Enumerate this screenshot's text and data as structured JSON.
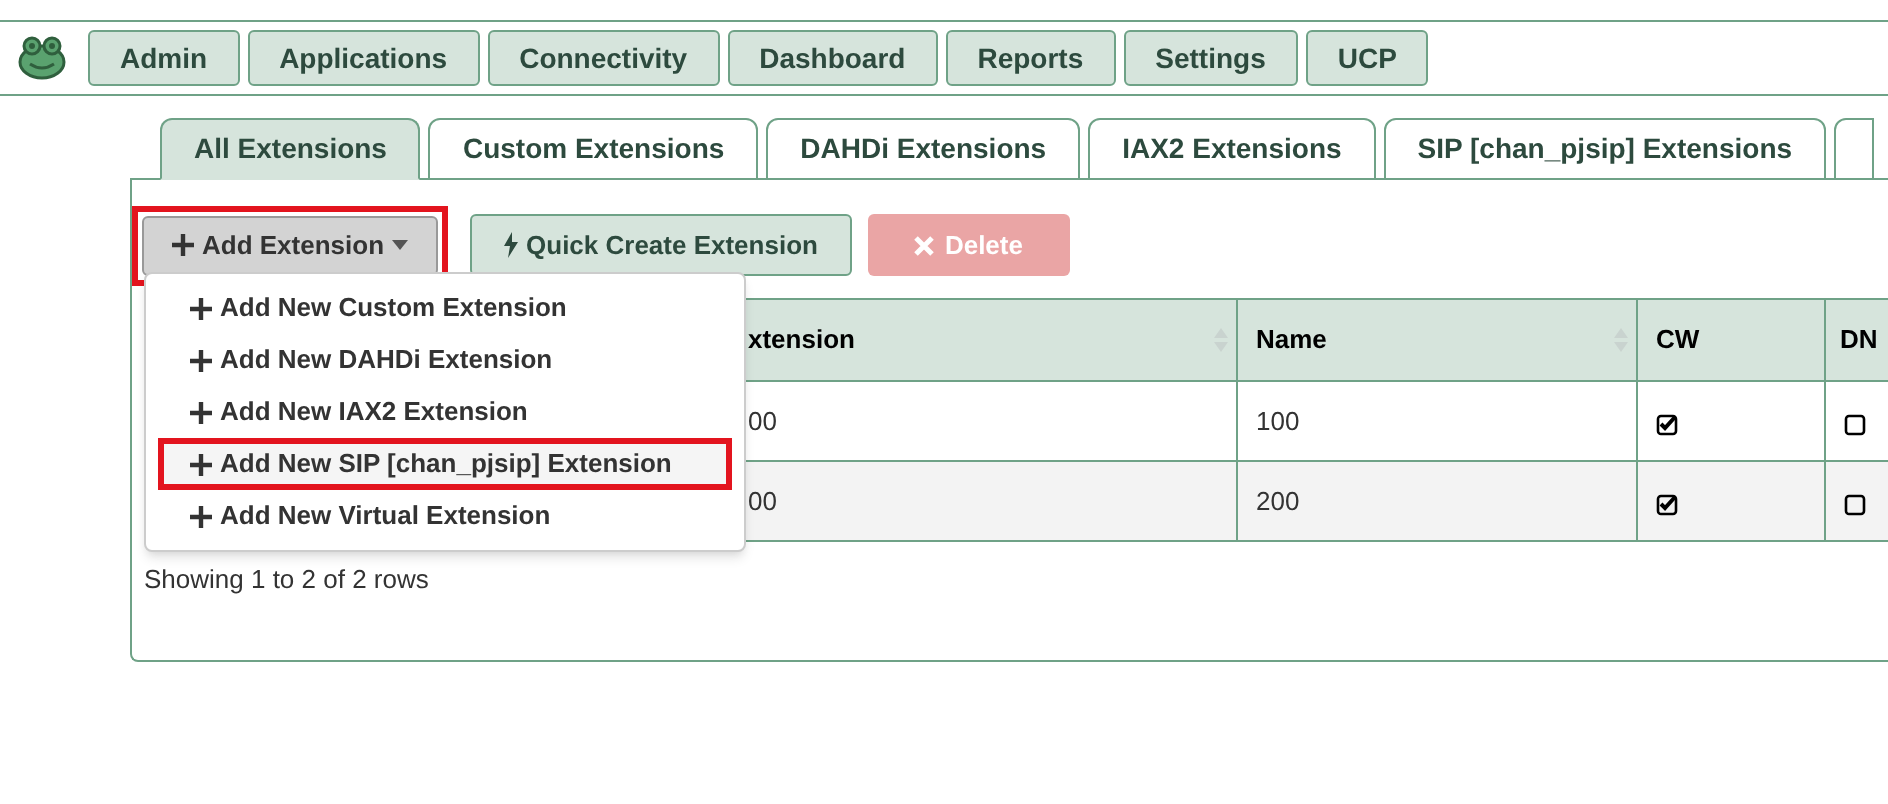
{
  "nav": [
    {
      "label": "Admin"
    },
    {
      "label": "Applications"
    },
    {
      "label": "Connectivity"
    },
    {
      "label": "Dashboard"
    },
    {
      "label": "Reports"
    },
    {
      "label": "Settings"
    },
    {
      "label": "UCP"
    }
  ],
  "tabs": [
    {
      "label": "All Extensions",
      "selected": true
    },
    {
      "label": "Custom Extensions",
      "selected": false
    },
    {
      "label": "DAHDi Extensions",
      "selected": false
    },
    {
      "label": "IAX2 Extensions",
      "selected": false
    },
    {
      "label": "SIP [chan_pjsip] Extensions",
      "selected": false
    }
  ],
  "toolbar": {
    "add_button": {
      "label": "Add Extension",
      "highlighted": true
    },
    "quick_button": {
      "label": "Quick Create Extension"
    },
    "delete_button": {
      "label": "Delete",
      "disabled": true
    }
  },
  "add_menu": [
    {
      "label": "Add New Custom Extension",
      "highlighted": false
    },
    {
      "label": "Add New DAHDi Extension",
      "highlighted": false
    },
    {
      "label": "Add New IAX2 Extension",
      "highlighted": false
    },
    {
      "label": "Add New SIP [chan_pjsip] Extension",
      "highlighted": true
    },
    {
      "label": "Add New Virtual Extension",
      "highlighted": false
    }
  ],
  "table": {
    "columns": [
      "xtension",
      "Name",
      "CW",
      "DN"
    ],
    "rows": [
      {
        "extension": "00",
        "name": "100",
        "cw": true,
        "dnd": false
      },
      {
        "extension": "00",
        "name": "200",
        "cw": true,
        "dnd": false
      }
    ]
  },
  "footer": "Showing 1 to 2 of 2 rows"
}
